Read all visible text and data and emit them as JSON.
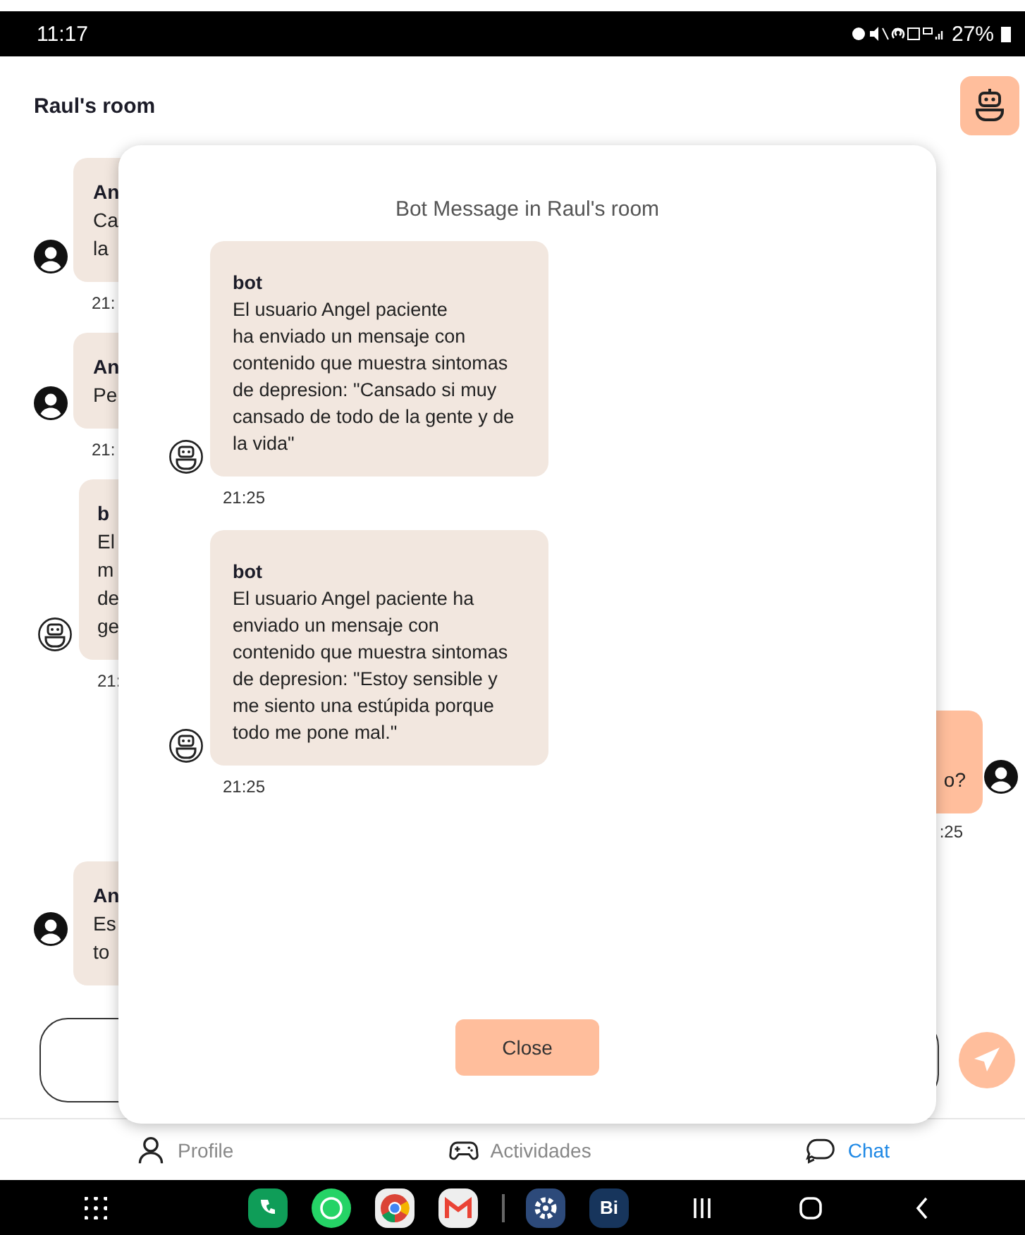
{
  "status_bar": {
    "time": "11:17",
    "battery": "27%"
  },
  "header": {
    "title": "Raul's room"
  },
  "background_messages": [
    {
      "kind": "incoming",
      "sender": "An",
      "lines": [
        "Ca",
        "la"
      ],
      "time": "21:"
    },
    {
      "kind": "incoming",
      "sender": "An",
      "lines": [
        "Pe"
      ],
      "time": "21:"
    },
    {
      "kind": "bot",
      "sender": "b",
      "lines": [
        "El",
        "m",
        "de",
        "ge"
      ],
      "time": "21:"
    },
    {
      "kind": "outgoing",
      "lines": [
        "o?"
      ],
      "time": ":25"
    },
    {
      "kind": "incoming",
      "sender": "An",
      "lines": [
        "Es",
        "to"
      ]
    }
  ],
  "modal": {
    "title": "Bot Message in Raul's room",
    "messages": [
      {
        "sender": "bot",
        "text": "El usuario Angel paciente\nha enviado un mensaje con contenido que muestra sintomas de depresion: \"Cansado si muy cansado de todo de la gente y de la vida\"",
        "time": "21:25"
      },
      {
        "sender": "bot",
        "text": "El usuario Angel paciente ha enviado un mensaje con contenido que muestra sintomas de depresion: \"Estoy sensible y me siento una estúpida porque todo me pone mal.\"",
        "time": "21:25"
      }
    ],
    "close_label": "Close"
  },
  "bottom_nav": [
    {
      "label": "Profile",
      "selected": false
    },
    {
      "label": "Actividades",
      "selected": false
    },
    {
      "label": "Chat",
      "selected": true
    }
  ],
  "dock": {
    "bi_label": "Bi"
  }
}
